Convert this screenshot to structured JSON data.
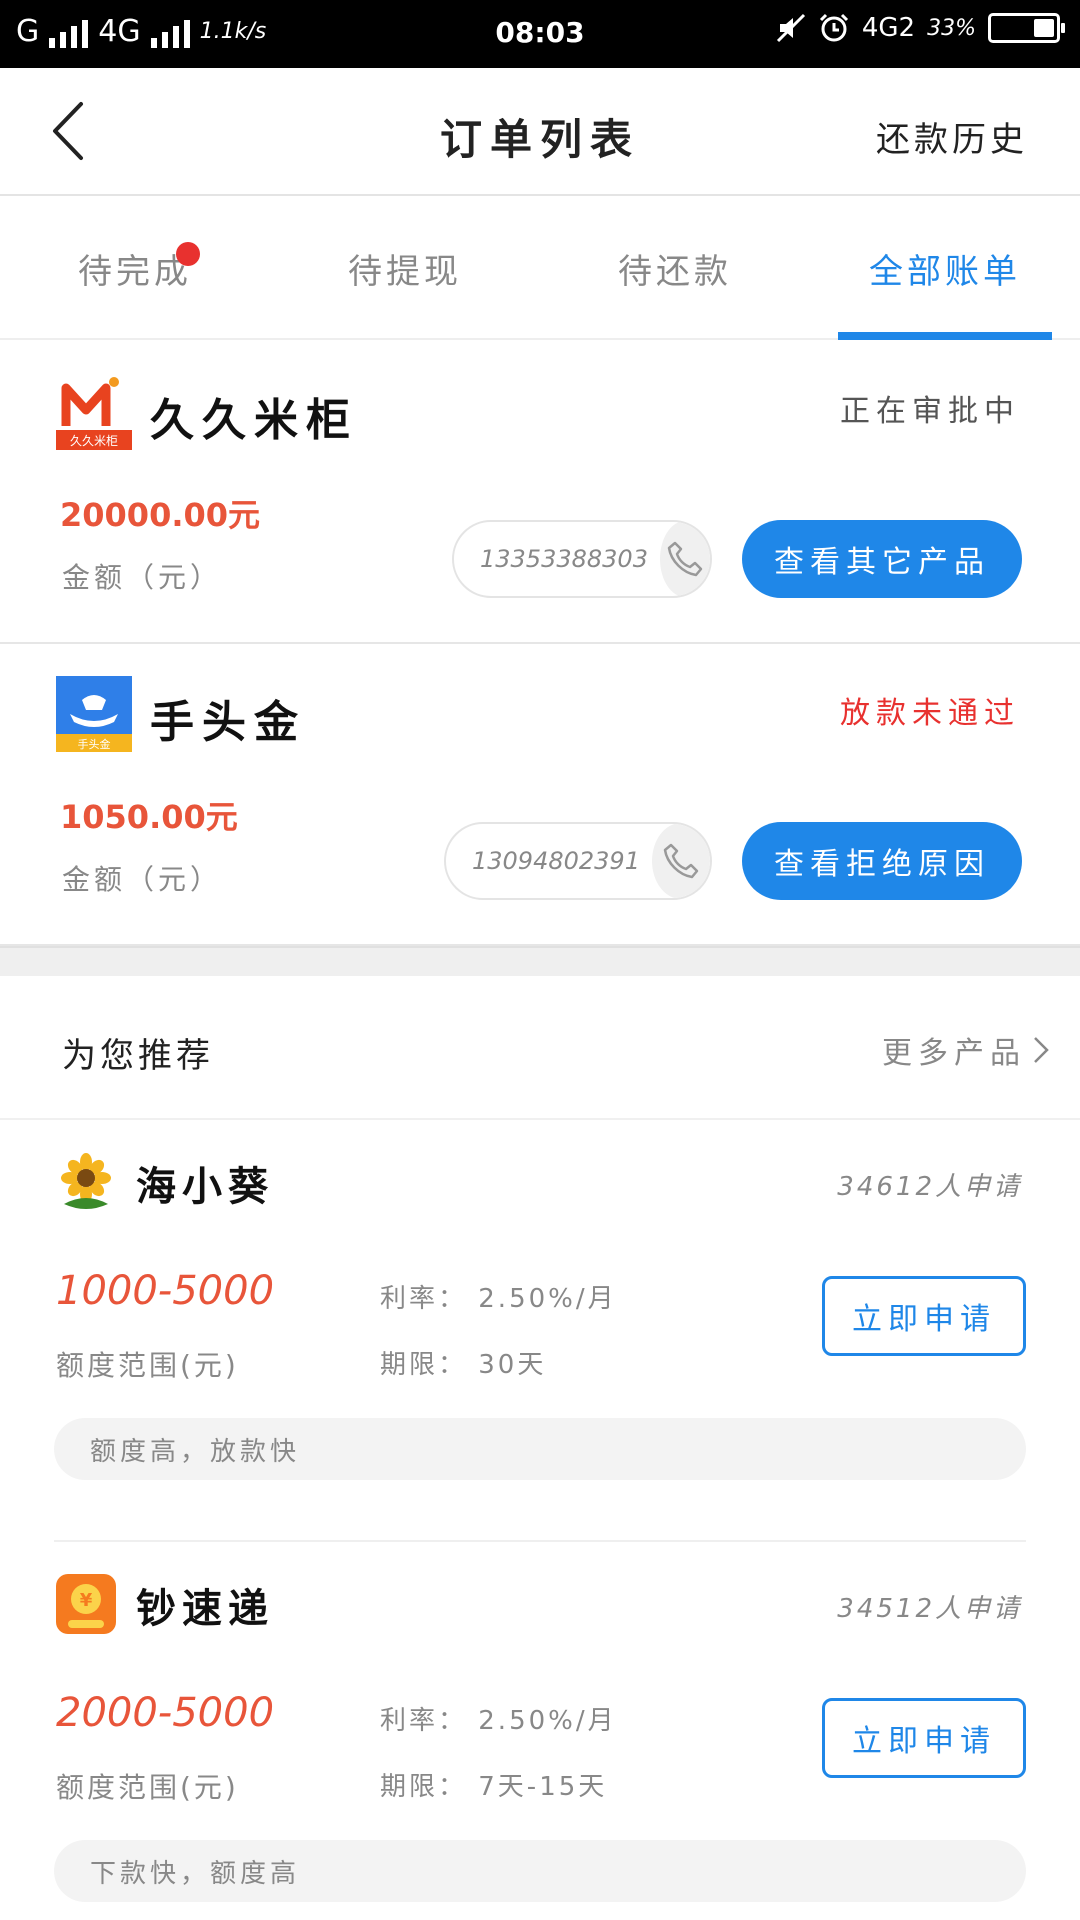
{
  "status_bar": {
    "carrier1": "G",
    "carrier2": "4G",
    "net_speed": "1.1k/s",
    "time": "08:03",
    "network_right": "4G2",
    "battery": "33%",
    "battery_level": 0.33
  },
  "header": {
    "title": "订单列表",
    "history_label": "还款历史"
  },
  "tabs": [
    {
      "label": "待完成",
      "has_dot": true
    },
    {
      "label": "待提现",
      "has_dot": false
    },
    {
      "label": "待还款",
      "has_dot": false
    },
    {
      "label": "全部账单",
      "active": true
    }
  ],
  "orders": [
    {
      "logo_icon": "jiujiu-migui-logo",
      "logo_caption": "久久米柜",
      "name": "久久米柜",
      "status": "正在审批中",
      "status_color": "#555555",
      "amount": "20000.00元",
      "amount_label": "金额（元）",
      "phone": "13353388303",
      "button_label": "查看其它产品"
    },
    {
      "logo_icon": "shoutoujin-logo",
      "logo_caption": "手头金",
      "name": "手头金",
      "status": "放款未通过",
      "status_color": "#e8312f",
      "amount": "1050.00元",
      "amount_label": "金额（元）",
      "phone": "13094802391",
      "button_label": "查看拒绝原因"
    }
  ],
  "recommend": {
    "title": "为您推荐",
    "more_label": "更多产品"
  },
  "products": [
    {
      "logo_icon": "sunflower-logo",
      "name": "海小葵",
      "applicants": "34612人申请",
      "range": "1000-5000",
      "range_label": "额度范围(元)",
      "rate": "利率： 2.50%/月",
      "term": "期限： 30天",
      "button_label": "立即申请",
      "tagline": "额度高，放款快"
    },
    {
      "logo_icon": "chaosudi-logo",
      "name": "钞速递",
      "applicants": "34512人申请",
      "range": "2000-5000",
      "range_label": "额度范围(元)",
      "rate": "利率： 2.50%/月",
      "term": "期限： 7天-15天",
      "button_label": "立即申请",
      "tagline": "下款快，额度高"
    }
  ],
  "colors": {
    "accent_blue": "#1f87e8",
    "amount_red": "#e8553a",
    "alert_red": "#e8312f"
  }
}
